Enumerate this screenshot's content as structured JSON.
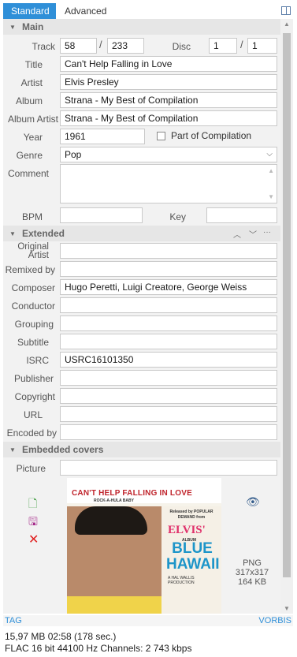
{
  "tabs": {
    "standard": "Standard",
    "advanced": "Advanced"
  },
  "sections": {
    "main": "Main",
    "extended": "Extended",
    "covers": "Embedded covers"
  },
  "labels": {
    "track": "Track",
    "disc": "Disc",
    "title": "Title",
    "artist": "Artist",
    "album": "Album",
    "album_artist": "Album Artist",
    "year": "Year",
    "part_of_compilation": "Part of Compilation",
    "genre": "Genre",
    "comment": "Comment",
    "bpm": "BPM",
    "key": "Key",
    "original_artist_1": "Original",
    "original_artist_2": "Artist",
    "remixed_by": "Remixed by",
    "composer": "Composer",
    "conductor": "Conductor",
    "grouping": "Grouping",
    "subtitle": "Subtitle",
    "isrc": "ISRC",
    "publisher": "Publisher",
    "copyright": "Copyright",
    "url": "URL",
    "encoded_by": "Encoded by",
    "picture": "Picture"
  },
  "values": {
    "track": "58",
    "track_total": "233",
    "disc": "1",
    "disc_total": "1",
    "title": "Can't Help Falling in Love",
    "artist": "Elvis Presley",
    "album": "Strana - My Best of Compilation",
    "album_artist": "Strana - My Best of Compilation",
    "year": "1961",
    "genre": "Pop",
    "comment": "",
    "bpm": "",
    "key": "",
    "original_artist": "",
    "remixed_by": "",
    "composer": "Hugo Peretti, Luigi Creatore, George Weiss",
    "conductor": "",
    "grouping": "",
    "subtitle": "",
    "isrc": "USRC16101350",
    "publisher": "",
    "copyright": "",
    "url": "",
    "encoded_by": "",
    "picture": ""
  },
  "cover": {
    "line1": "CAN'T HELP FALLING IN LOVE",
    "line2": "ROCK-A-HULA BABY",
    "released": "Released by POPULAR DEMAND from",
    "elvis": "ELVIS'",
    "album": "ALBUM",
    "blue_hawaii": "BLUE HAWAII",
    "production": "A HAL WALLIS PRODUCTION",
    "format": "PNG",
    "dimensions": "317x317",
    "size": "164 KB"
  },
  "footer": {
    "tag": "TAG",
    "tag_type": "VORBIS",
    "line1": "15,97 MB  02:58 (178 sec.)",
    "line2": "FLAC  16 bit  44100 Hz  Channels: 2  743 kbps"
  }
}
